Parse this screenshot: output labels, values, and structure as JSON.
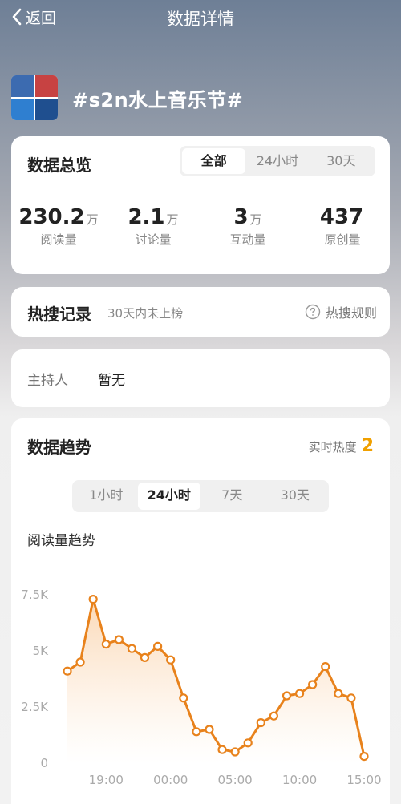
{
  "nav": {
    "back_label": "返回",
    "title": "数据详情"
  },
  "topic": {
    "title": "#s2n水上音乐节#"
  },
  "overview": {
    "title": "数据总览",
    "tabs": [
      "全部",
      "24小时",
      "30天"
    ],
    "active_tab": "全部",
    "stats": [
      {
        "value": "230.2",
        "unit": "万",
        "label": "阅读量"
      },
      {
        "value": "2.1",
        "unit": "万",
        "label": "讨论量"
      },
      {
        "value": "3",
        "unit": "万",
        "label": "互动量"
      },
      {
        "value": "437",
        "unit": "",
        "label": "原创量"
      }
    ]
  },
  "hot_search": {
    "title": "热搜记录",
    "status": "30天内未上榜",
    "rules_label": "热搜规则"
  },
  "host": {
    "label": "主持人",
    "value": "暂无"
  },
  "trend": {
    "title": "数据趋势",
    "heat_label": "实时热度",
    "heat_value": "2",
    "range_tabs": [
      "1小时",
      "24小时",
      "7天",
      "30天"
    ],
    "active_range": "24小时",
    "chart_label": "阅读量趋势"
  },
  "colors": {
    "line": "#e8821c",
    "fill_top": "#fbd9b7",
    "heat": "#f0a000"
  },
  "chart_data": {
    "type": "area",
    "title": "阅读量趋势",
    "y_ticks": [
      "0",
      "2.5K",
      "5K",
      "7.5K"
    ],
    "ylim": [
      0,
      7500
    ],
    "x_ticks": [
      "19:00",
      "00:00",
      "05:00",
      "10:00",
      "15:00"
    ],
    "x_tick_index": [
      3,
      8,
      13,
      18,
      23
    ],
    "values": [
      4100,
      4500,
      7300,
      5300,
      5500,
      5100,
      4700,
      5200,
      4600,
      2900,
      1400,
      1500,
      600,
      500,
      900,
      1800,
      2100,
      3000,
      3100,
      3500,
      4300,
      3100,
      2900,
      300
    ],
    "grid": false,
    "legend": "none"
  }
}
